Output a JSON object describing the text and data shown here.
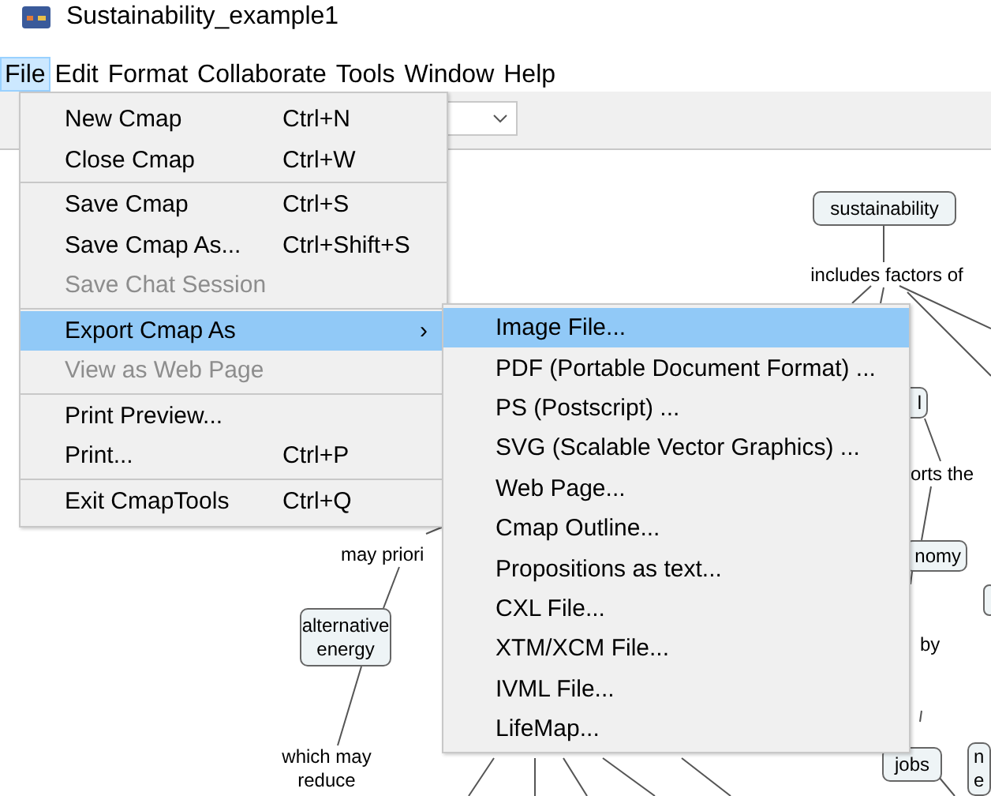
{
  "window": {
    "title": "Sustainability_example1"
  },
  "menu_bar": [
    {
      "label": "File",
      "selected": true
    },
    {
      "label": "Edit",
      "selected": false
    },
    {
      "label": "Format",
      "selected": false
    },
    {
      "label": "Collaborate",
      "selected": false
    },
    {
      "label": "Tools",
      "selected": false
    },
    {
      "label": "Window",
      "selected": false
    },
    {
      "label": "Help",
      "selected": false
    }
  ],
  "file_menu": [
    {
      "kind": "item",
      "label": "New Cmap",
      "shortcut": "Ctrl+N",
      "disabled": false,
      "selected": false
    },
    {
      "kind": "item",
      "label": "Close Cmap",
      "shortcut": "Ctrl+W",
      "disabled": false,
      "selected": false
    },
    {
      "kind": "separator"
    },
    {
      "kind": "item",
      "label": "Save Cmap",
      "shortcut": "Ctrl+S",
      "disabled": false,
      "selected": false
    },
    {
      "kind": "item",
      "label": "Save Cmap As...",
      "shortcut": "Ctrl+Shift+S",
      "disabled": false,
      "selected": false
    },
    {
      "kind": "item",
      "label": "Save Chat Session",
      "disabled": true,
      "selected": false
    },
    {
      "kind": "separator"
    },
    {
      "kind": "submenu",
      "label": "Export Cmap As",
      "arrow": "›",
      "disabled": false,
      "selected": true
    },
    {
      "kind": "item",
      "label": "View as Web Page",
      "disabled": true,
      "selected": false
    },
    {
      "kind": "separator"
    },
    {
      "kind": "item",
      "label": "Print Preview...",
      "disabled": false,
      "selected": false
    },
    {
      "kind": "item",
      "label": "Print...",
      "shortcut": "Ctrl+P",
      "disabled": false,
      "selected": false
    },
    {
      "kind": "separator"
    },
    {
      "kind": "item",
      "label": "Exit CmapTools",
      "shortcut": "Ctrl+Q",
      "disabled": false,
      "selected": false
    }
  ],
  "export_submenu": [
    {
      "label": "Image File...",
      "selected": true
    },
    {
      "label": "PDF (Portable Document Format) ...",
      "selected": false
    },
    {
      "label": "PS (Postscript) ...",
      "selected": false
    },
    {
      "label": "SVG (Scalable Vector Graphics) ...",
      "selected": false
    },
    {
      "label": "Web Page...",
      "selected": false
    },
    {
      "label": "Cmap Outline...",
      "selected": false
    },
    {
      "label": "Propositions as text...",
      "selected": false
    },
    {
      "label": "CXL File...",
      "selected": false
    },
    {
      "label": "XTM/XCM File...",
      "selected": false
    },
    {
      "label": "IVML File...",
      "selected": false
    },
    {
      "label": "LifeMap...",
      "selected": false
    }
  ],
  "concept_map": [
    {
      "kind": "concept",
      "text": "sustainability"
    },
    {
      "kind": "phrase",
      "text": "includes factors of"
    },
    {
      "kind": "concept",
      "text": "l"
    },
    {
      "kind": "phrase",
      "text": "orts the"
    },
    {
      "kind": "concept",
      "text": "nomy"
    },
    {
      "kind": "phrase",
      "text": "by"
    },
    {
      "kind": "phrase",
      "text": "may priori"
    },
    {
      "kind": "concept",
      "text": "alternative energy"
    },
    {
      "kind": "phrase",
      "text": "which may reduce"
    },
    {
      "kind": "concept",
      "text": "jobs"
    },
    {
      "kind": "concept",
      "text": "n e"
    }
  ]
}
